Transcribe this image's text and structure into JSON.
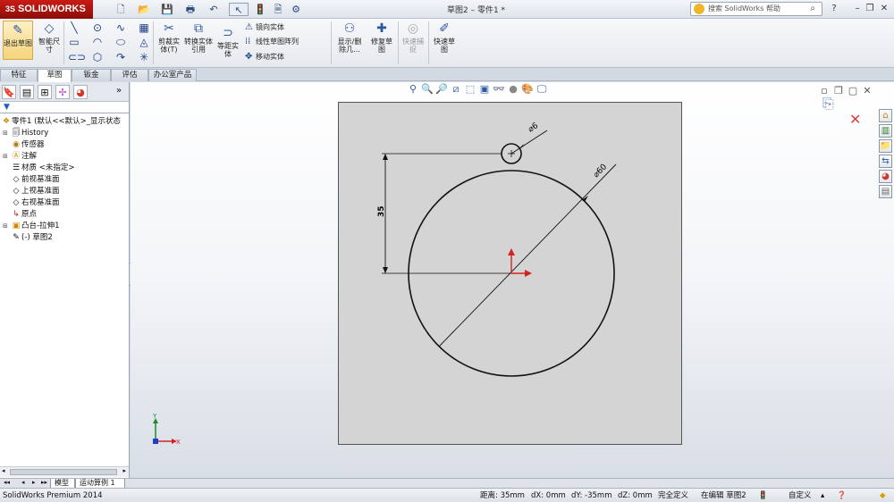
{
  "titlebar": {
    "brand": "SOLIDWORKS",
    "window_title": "草图2 – 零件1 *",
    "help_search_placeholder": "搜索 SolidWorks 帮助",
    "help_label": "?"
  },
  "ribbon": {
    "exit_sketch": "退出草图",
    "smart_dimension": "智能尺寸",
    "trim": "剪裁实体(T)",
    "convert": "转换实体引用",
    "offset": "等距实体",
    "mirror": "镜向实体",
    "linear_pattern": "线性草图阵列",
    "move": "移动实体",
    "show_delete_relations": "显示/删除几...",
    "repair_sketch": "修复草图",
    "quick_snaps": "快速捕捉",
    "rapid_sketch": "快速草图"
  },
  "tabs": [
    {
      "label": "特征"
    },
    {
      "label": "草图"
    },
    {
      "label": "钣金"
    },
    {
      "label": "评估"
    },
    {
      "label": "办公室产品"
    }
  ],
  "tree": {
    "root": "零件1 (默认<<默认>_显示状态",
    "items": [
      {
        "label": "History"
      },
      {
        "label": "传感器"
      },
      {
        "label": "注解"
      },
      {
        "label": "材质 <未指定>"
      },
      {
        "label": "前视基准面"
      },
      {
        "label": "上视基准面"
      },
      {
        "label": "右视基准面"
      },
      {
        "label": "原点"
      },
      {
        "label": "凸台-拉伸1"
      },
      {
        "label": "(-) 草图2"
      }
    ]
  },
  "sketch": {
    "small_dim": "⌀6",
    "large_dim": "⌀60",
    "vertical_dim": "35"
  },
  "bottom_tabs": {
    "model": "模型",
    "motion": "运动算例 1"
  },
  "status": {
    "product": "SolidWorks Premium 2014",
    "distance": "距离: 35mm",
    "dx": "dX: 0mm",
    "dy": "dY: -35mm",
    "dz": "dZ: 0mm",
    "defined": "完全定义",
    "editing": "在编辑 草图2",
    "custom": "自定义"
  },
  "colors": {
    "accent_red": "#c81c14",
    "sketch_bg": "#d4d4d4",
    "axis_y": "#1a8a2a",
    "axis_x": "#d42222",
    "axis_z": "#1c3fd0"
  }
}
